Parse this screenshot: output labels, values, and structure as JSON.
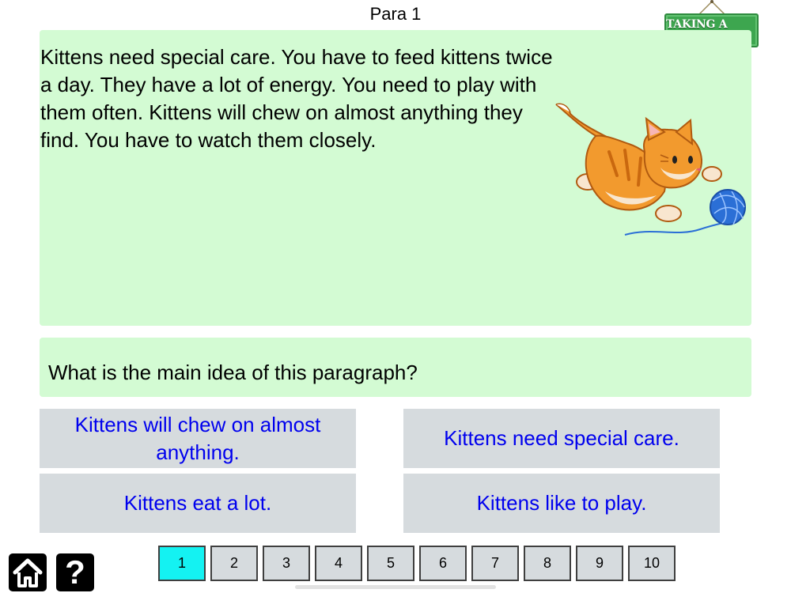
{
  "header": {
    "title": "Para 1"
  },
  "break_button": {
    "label": "TAKING A BREAK"
  },
  "passage": {
    "text": "Kittens need special care. You have to feed kittens twice a day. They have a lot of energy. You need to play with them often. Kittens will chew on almost anything they find. You have to watch them closely.",
    "image": "kitten-playing-with-yarn-ball"
  },
  "question": {
    "text": "What is the main idea of this paragraph?"
  },
  "answers": [
    {
      "label": "Kittens will chew on almost anything."
    },
    {
      "label": "Kittens need special care."
    },
    {
      "label": "Kittens eat a lot."
    },
    {
      "label": "Kittens like to play."
    }
  ],
  "footer": {
    "home_icon": "home-icon",
    "help_icon": "help-icon",
    "help_label": "?"
  },
  "pagination": {
    "current": 1,
    "pages": [
      "1",
      "2",
      "3",
      "4",
      "5",
      "6",
      "7",
      "8",
      "9",
      "10"
    ]
  },
  "colors": {
    "panel_green": "#d3fbd3",
    "answer_gray": "#d6dbde",
    "answer_text_blue": "#0000ee",
    "active_page_cyan": "#14f2f2",
    "break_green": "#3da64f"
  }
}
